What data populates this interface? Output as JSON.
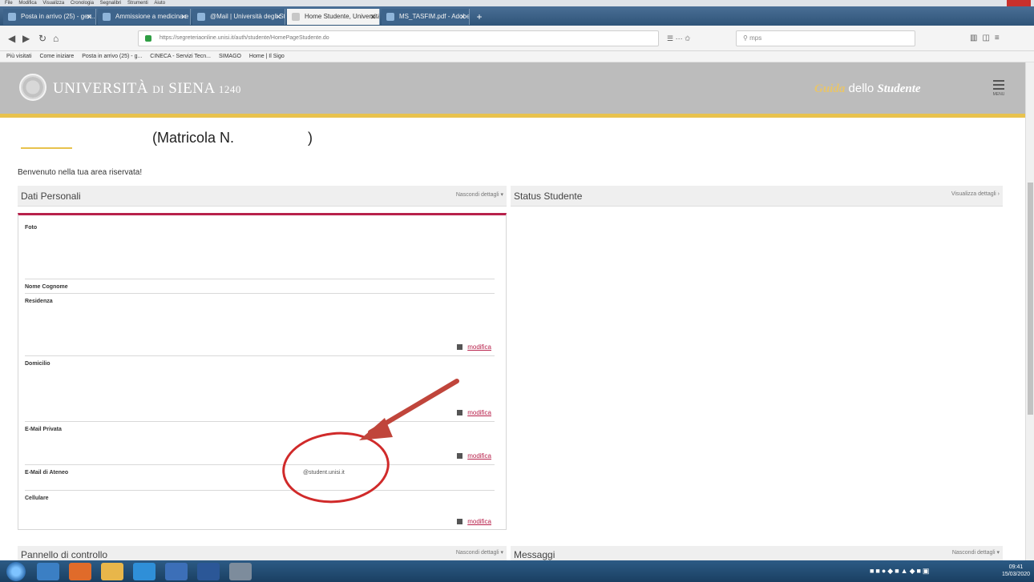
{
  "browser": {
    "menu": [
      "File",
      "Modifica",
      "Visualizza",
      "Cronologia",
      "Segnalibri",
      "Strumenti",
      "Aiuto"
    ],
    "tabs": [
      {
        "label": "Posta in arrivo (25) - gen...",
        "active": false
      },
      {
        "label": "Ammissione a medicina e chi...",
        "active": false
      },
      {
        "label": "@Mail | Università degli Stud...",
        "active": false
      },
      {
        "label": "Home Studente, Università d...",
        "active": true
      },
      {
        "label": "MS_TASFIM.pdf - Adobe R...",
        "active": false
      }
    ],
    "new_tab_label": "+",
    "url": "https://segreteriaonline.unisi.it/auth/studente/HomePageStudente.do",
    "search_placeholder": "mps",
    "bookmarks": [
      "Più visitati",
      "Come iniziare",
      "Posta in arrivo (25) - g...",
      "CINECA - Servizi Tecn...",
      "SIMAGO",
      "Home | Il Sigo"
    ]
  },
  "site": {
    "name_part1": "UNIVERSITÀ",
    "name_part2": "DI",
    "name_part3": "SIENA",
    "name_part4": "1240",
    "guide_word1": "Guida",
    "guide_word2": "dello",
    "guide_word3": "Studente",
    "menu_label": "MENU"
  },
  "page": {
    "matricola_label": "(Matricola N.",
    "matricola_close": ")",
    "welcome": "Benvenuto nella tua area riservata!",
    "left_section_title": "Dati Personali",
    "left_section_link": "Nascondi dettagli",
    "right_section_title": "Status Studente",
    "right_section_link": "Visualizza dettagli",
    "fields": {
      "foto": "Foto",
      "nome_cognome": "Nome Cognome",
      "residenza": "Residenza",
      "domicilio": "Domicilio",
      "email_privata": "E-Mail Privata",
      "email_ateneo": "E-Mail di Ateneo",
      "email_ateneo_value": "@student.unisi.it",
      "cellulare": "Cellulare"
    },
    "edit_label": "modifica",
    "bottom_left_title": "Pannello di controllo",
    "bottom_left_link": "Nascondi dettagli",
    "bottom_right_title": "Messaggi",
    "bottom_right_link": "Nascondi dettagli"
  },
  "taskbar": {
    "clock_time": "09:41",
    "clock_date": "15/03/2020"
  },
  "colors": {
    "header_gray": "#bcbcbc",
    "gold": "#e8c24d",
    "accent_crimson": "#b8214b",
    "annotation_red": "#d02a2a"
  }
}
